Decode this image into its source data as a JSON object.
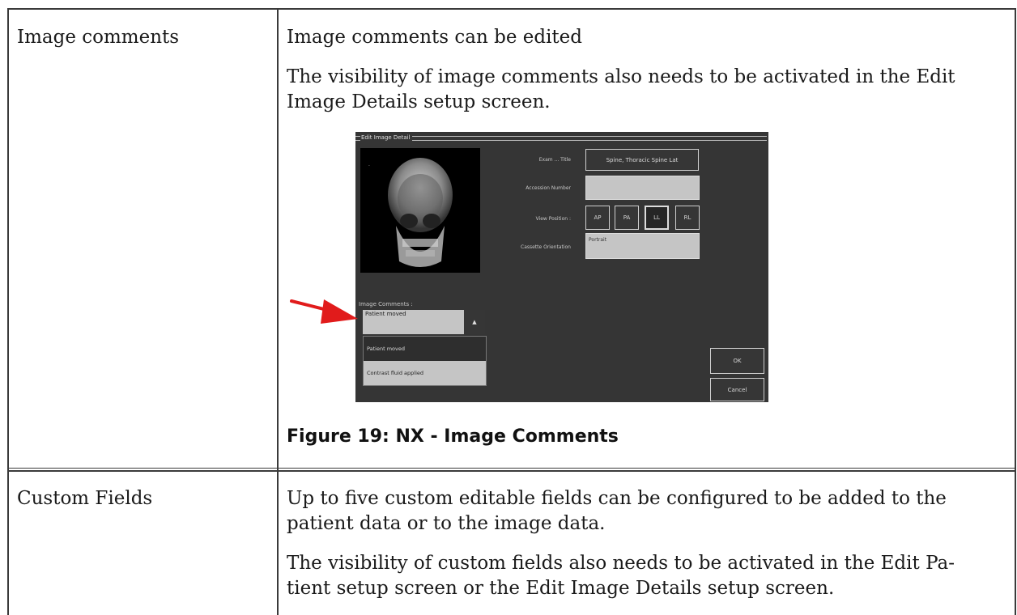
{
  "rows": [
    {
      "label": "Image comments",
      "paragraphs": [
        "Image comments can be edited",
        "The visibility of image comments also needs to be activated in the Edit",
        "Image Details setup screen."
      ],
      "figure_caption": "Figure 19: NX - Image Comments"
    },
    {
      "label": "Custom Fields",
      "paragraphs": [
        "Up to five custom editable fields can be configured to be added to the",
        "patient data or to the image data.",
        "The visibility of custom fields also needs to be activated in the Edit Pa-",
        "tient setup screen or the Edit Image Details setup screen."
      ]
    }
  ],
  "screenshot": {
    "window_title": "Edit Image Detail",
    "exam_title_label": "Exam ... Title",
    "exam_title_value": "Spine, Thoracic Spine Lat",
    "accession_label": "Accession Number",
    "view_position_label": "View Position :",
    "view_positions": [
      "AP",
      "PA",
      "LL",
      "RL"
    ],
    "cassette_label": "Cassette Orientation",
    "cassette_value": "Portrait",
    "image_comments_label": "Image Comments :",
    "image_comments_value": "Patient moved",
    "dropdown_arrow": "▲",
    "dropdown_options": [
      "Patient moved",
      "Contrast fluid applied"
    ],
    "ok_label": "OK",
    "cancel_label": "Cancel",
    "arrow_color": "#e11b1b"
  }
}
